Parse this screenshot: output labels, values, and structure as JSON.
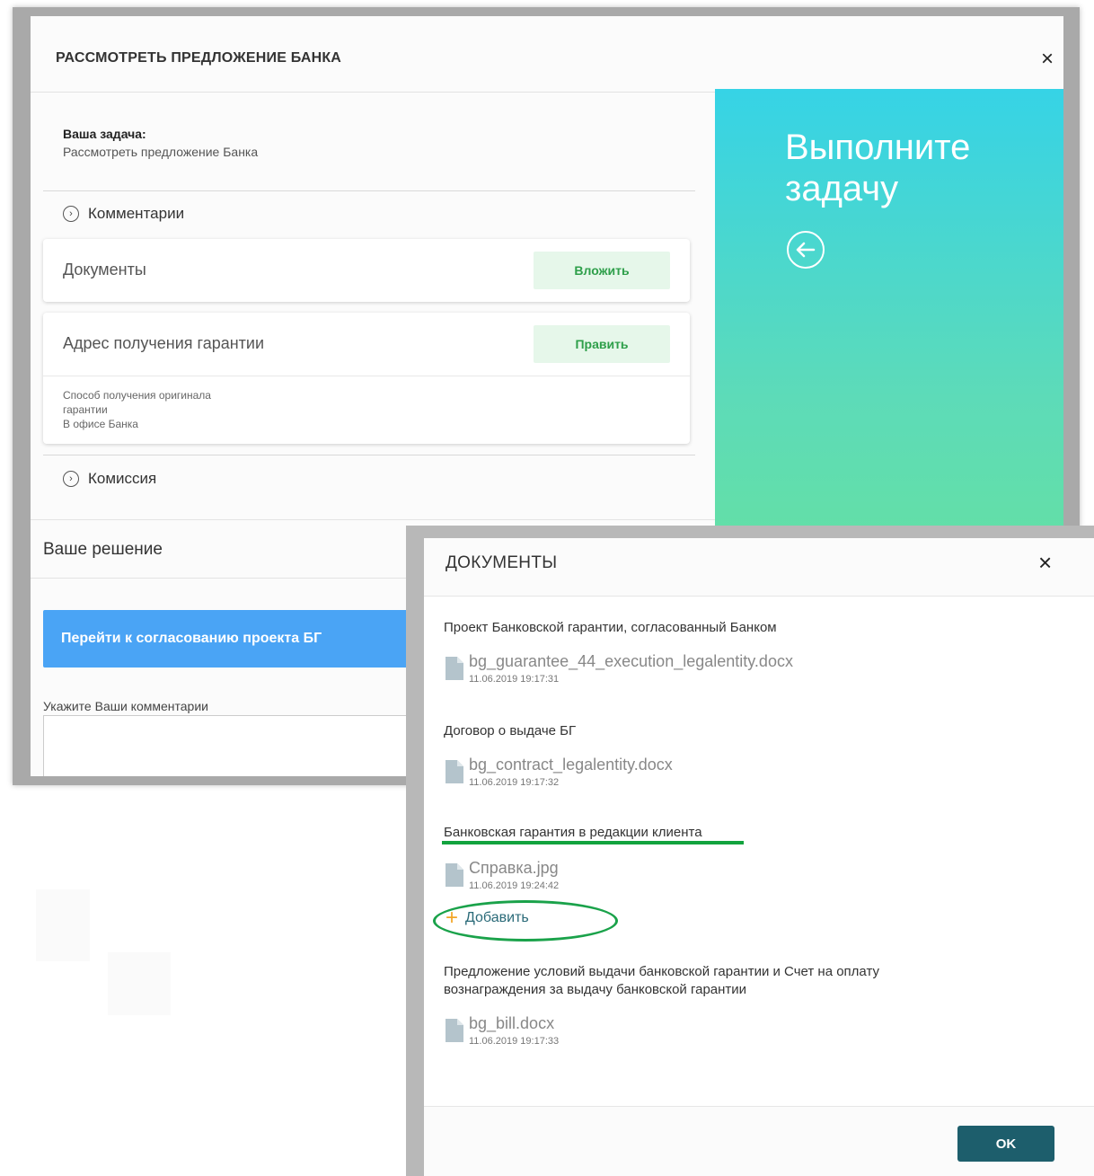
{
  "main_modal": {
    "title": "РАССМОТРЕТЬ ПРЕДЛОЖЕНИЕ БАНКА",
    "close": "×",
    "task_label": "Ваша задача:",
    "task_text": "Рассмотреть предложение Банка",
    "comments_section": "Комментарии",
    "documents_card": {
      "label": "Документы",
      "button": "Вложить"
    },
    "address_card": {
      "label": "Адрес получения гарантии",
      "button": "Править",
      "sub_line1": "Способ получения оригинала",
      "sub_line2": "гарантии",
      "sub_line3": "В офисе Банка"
    },
    "commission_section": "Комиссия",
    "decision_title": "Ваше решение",
    "approve_button": "Перейти к согласованию проекта БГ",
    "comment_label": "Укажите Ваши комментарии",
    "side_panel": {
      "title": "Выполните задачу",
      "icon": "arrow-left-circle-icon"
    }
  },
  "documents_modal": {
    "title": "ДОКУМЕНТЫ",
    "close": "×",
    "sections": [
      {
        "title": "Проект Банковской гарантии, согласованный Банком",
        "file": "bg_guarantee_44_execution_legalentity.docx",
        "date": "11.06.2019 19:17:31"
      },
      {
        "title": "Договор о выдаче БГ",
        "file": "bg_contract_legalentity.docx",
        "date": "11.06.2019 19:17:32"
      },
      {
        "title": "Банковская гарантия в редакции клиента",
        "file": "Справка.jpg",
        "date": "11.06.2019 19:24:42"
      },
      {
        "title": "Предложение условий выдачи банковской гарантии и Счет на оплату вознаграждения за выдачу банковской гарантии",
        "file": "bg_bill.docx",
        "date": "11.06.2019 19:17:33"
      }
    ],
    "add_label": "Добавить",
    "ok_button": "OK"
  },
  "colors": {
    "accent_green": "#12a33e",
    "button_blue": "#4aa4f5",
    "ok_teal": "#1d5e6c",
    "plus_orange": "#f2a627"
  }
}
